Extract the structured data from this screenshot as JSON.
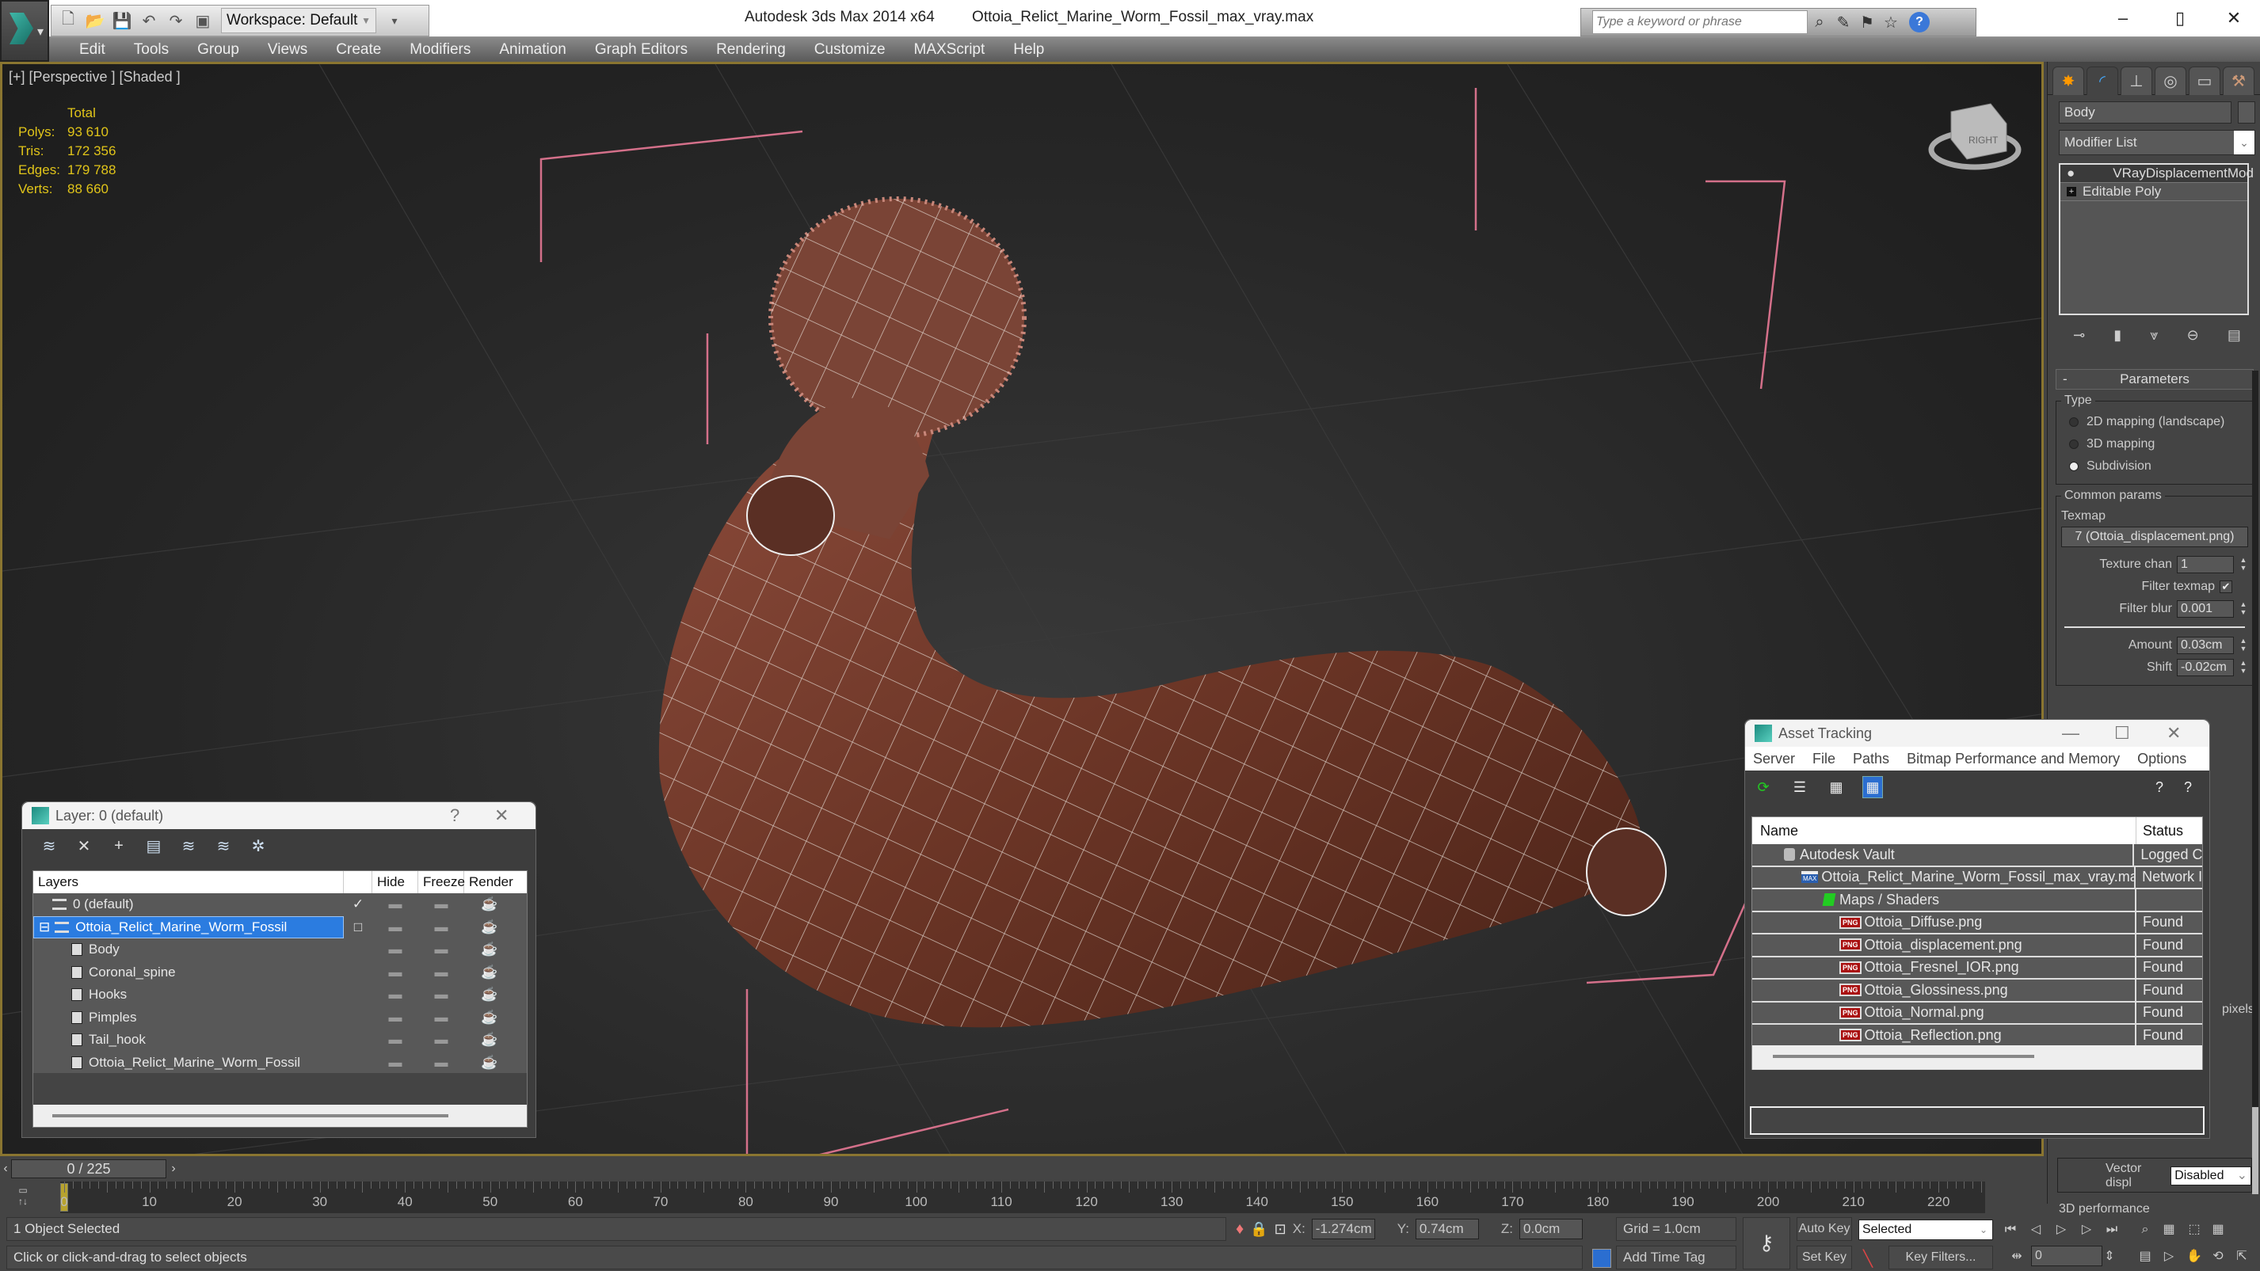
{
  "titlebar": {
    "app": "Autodesk 3ds Max  2014 x64",
    "file": "Ottoia_Relict_Marine_Worm_Fossil_max_vray.max",
    "workspace": "Workspace: Default",
    "search_placeholder": "Type a keyword or phrase"
  },
  "menu": [
    "Edit",
    "Tools",
    "Group",
    "Views",
    "Create",
    "Modifiers",
    "Animation",
    "Graph Editors",
    "Rendering",
    "Customize",
    "MAXScript",
    "Help"
  ],
  "viewport": {
    "label": "[+] [Perspective ] [Shaded ]",
    "stats": {
      "header": "Total",
      "rows": [
        {
          "k": "Polys:",
          "v": "93 610"
        },
        {
          "k": "Tris:",
          "v": "172 356"
        },
        {
          "k": "Edges:",
          "v": "179 788"
        },
        {
          "k": "Verts:",
          "v": "88 660"
        }
      ]
    },
    "viewcube_face": "RIGHT"
  },
  "layer_dialog": {
    "title": "Layer: 0 (default)",
    "help": "?",
    "columns": {
      "layers": "Layers",
      "hide": "Hide",
      "freeze": "Freeze",
      "render": "Render"
    },
    "rows": [
      {
        "name": "0 (default)",
        "type": "layer",
        "current": "✓",
        "selected": false
      },
      {
        "name": "Ottoia_Relict_Marine_Worm_Fossil",
        "type": "layer",
        "current": "□",
        "selected": true
      },
      {
        "name": "Body",
        "type": "object"
      },
      {
        "name": "Coronal_spine",
        "type": "object"
      },
      {
        "name": "Hooks",
        "type": "object"
      },
      {
        "name": "Pimples",
        "type": "object"
      },
      {
        "name": "Tail_hook",
        "type": "object"
      },
      {
        "name": "Ottoia_Relict_Marine_Worm_Fossil",
        "type": "object"
      }
    ]
  },
  "asset_dialog": {
    "title": "Asset Tracking",
    "menu": [
      "Server",
      "File",
      "Paths",
      "Bitmap Performance and Memory",
      "Options"
    ],
    "columns": {
      "name": "Name",
      "status": "Status"
    },
    "rows": [
      {
        "name": "Autodesk Vault",
        "status": "Logged C",
        "icon": "vault"
      },
      {
        "name": "Ottoia_Relict_Marine_Worm_Fossil_max_vray.max",
        "status": "Network I",
        "icon": "max"
      },
      {
        "name": "Maps / Shaders",
        "status": "",
        "icon": "maps"
      },
      {
        "name": "Ottoia_Diffuse.png",
        "status": "Found",
        "icon": "png"
      },
      {
        "name": "Ottoia_displacement.png",
        "status": "Found",
        "icon": "png"
      },
      {
        "name": "Ottoia_Fresnel_IOR.png",
        "status": "Found",
        "icon": "png"
      },
      {
        "name": "Ottoia_Glossiness.png",
        "status": "Found",
        "icon": "png"
      },
      {
        "name": "Ottoia_Normal.png",
        "status": "Found",
        "icon": "png"
      },
      {
        "name": "Ottoia_Reflection.png",
        "status": "Found",
        "icon": "png"
      }
    ]
  },
  "command_panel": {
    "object_name": "Body",
    "modifier_list": "Modifier List",
    "stack": [
      "VRayDisplacementMod",
      "Editable Poly"
    ],
    "parameters": {
      "rollout": "Parameters",
      "type_label": "Type",
      "types": [
        {
          "label": "2D mapping (landscape)",
          "on": false
        },
        {
          "label": "3D mapping",
          "on": false
        },
        {
          "label": "Subdivision",
          "on": true
        }
      ],
      "common_label": "Common params",
      "texmap_label": "Texmap",
      "texmap": "7 (Ottoia_displacement.png)",
      "texture_chan_label": "Texture chan",
      "texture_chan": "1",
      "filter_texmap_label": "Filter texmap",
      "filter_texmap": true,
      "filter_blur_label": "Filter blur",
      "filter_blur": "0.001",
      "amount_label": "Amount",
      "amount": "0.03cm",
      "shift_label": "Shift",
      "shift": "-0.02cm",
      "pixels_label": "pixels",
      "vector_label": "Vector displ",
      "vector": "Disabled",
      "perf_label": "3D performance"
    }
  },
  "timeline": {
    "slider": "0 / 225",
    "current": 0,
    "end": 225,
    "ticks": [
      0,
      10,
      20,
      30,
      40,
      50,
      60,
      70,
      80,
      90,
      100,
      110,
      120,
      130,
      140,
      150,
      160,
      170,
      180,
      190,
      200,
      210,
      220
    ]
  },
  "status": {
    "selection": "1 Object Selected",
    "prompt": "Click or click-and-drag to select objects",
    "x_label": "X:",
    "x": "-1.274cm",
    "y_label": "Y:",
    "y": "0.74cm",
    "z_label": "Z:",
    "z": "0.0cm",
    "grid": "Grid = 1.0cm",
    "add_time_tag": "Add Time Tag",
    "auto_key": "Auto Key",
    "set_key": "Set Key",
    "key_mode": "Selected",
    "key_filters": "Key Filters...",
    "frame": "0"
  }
}
